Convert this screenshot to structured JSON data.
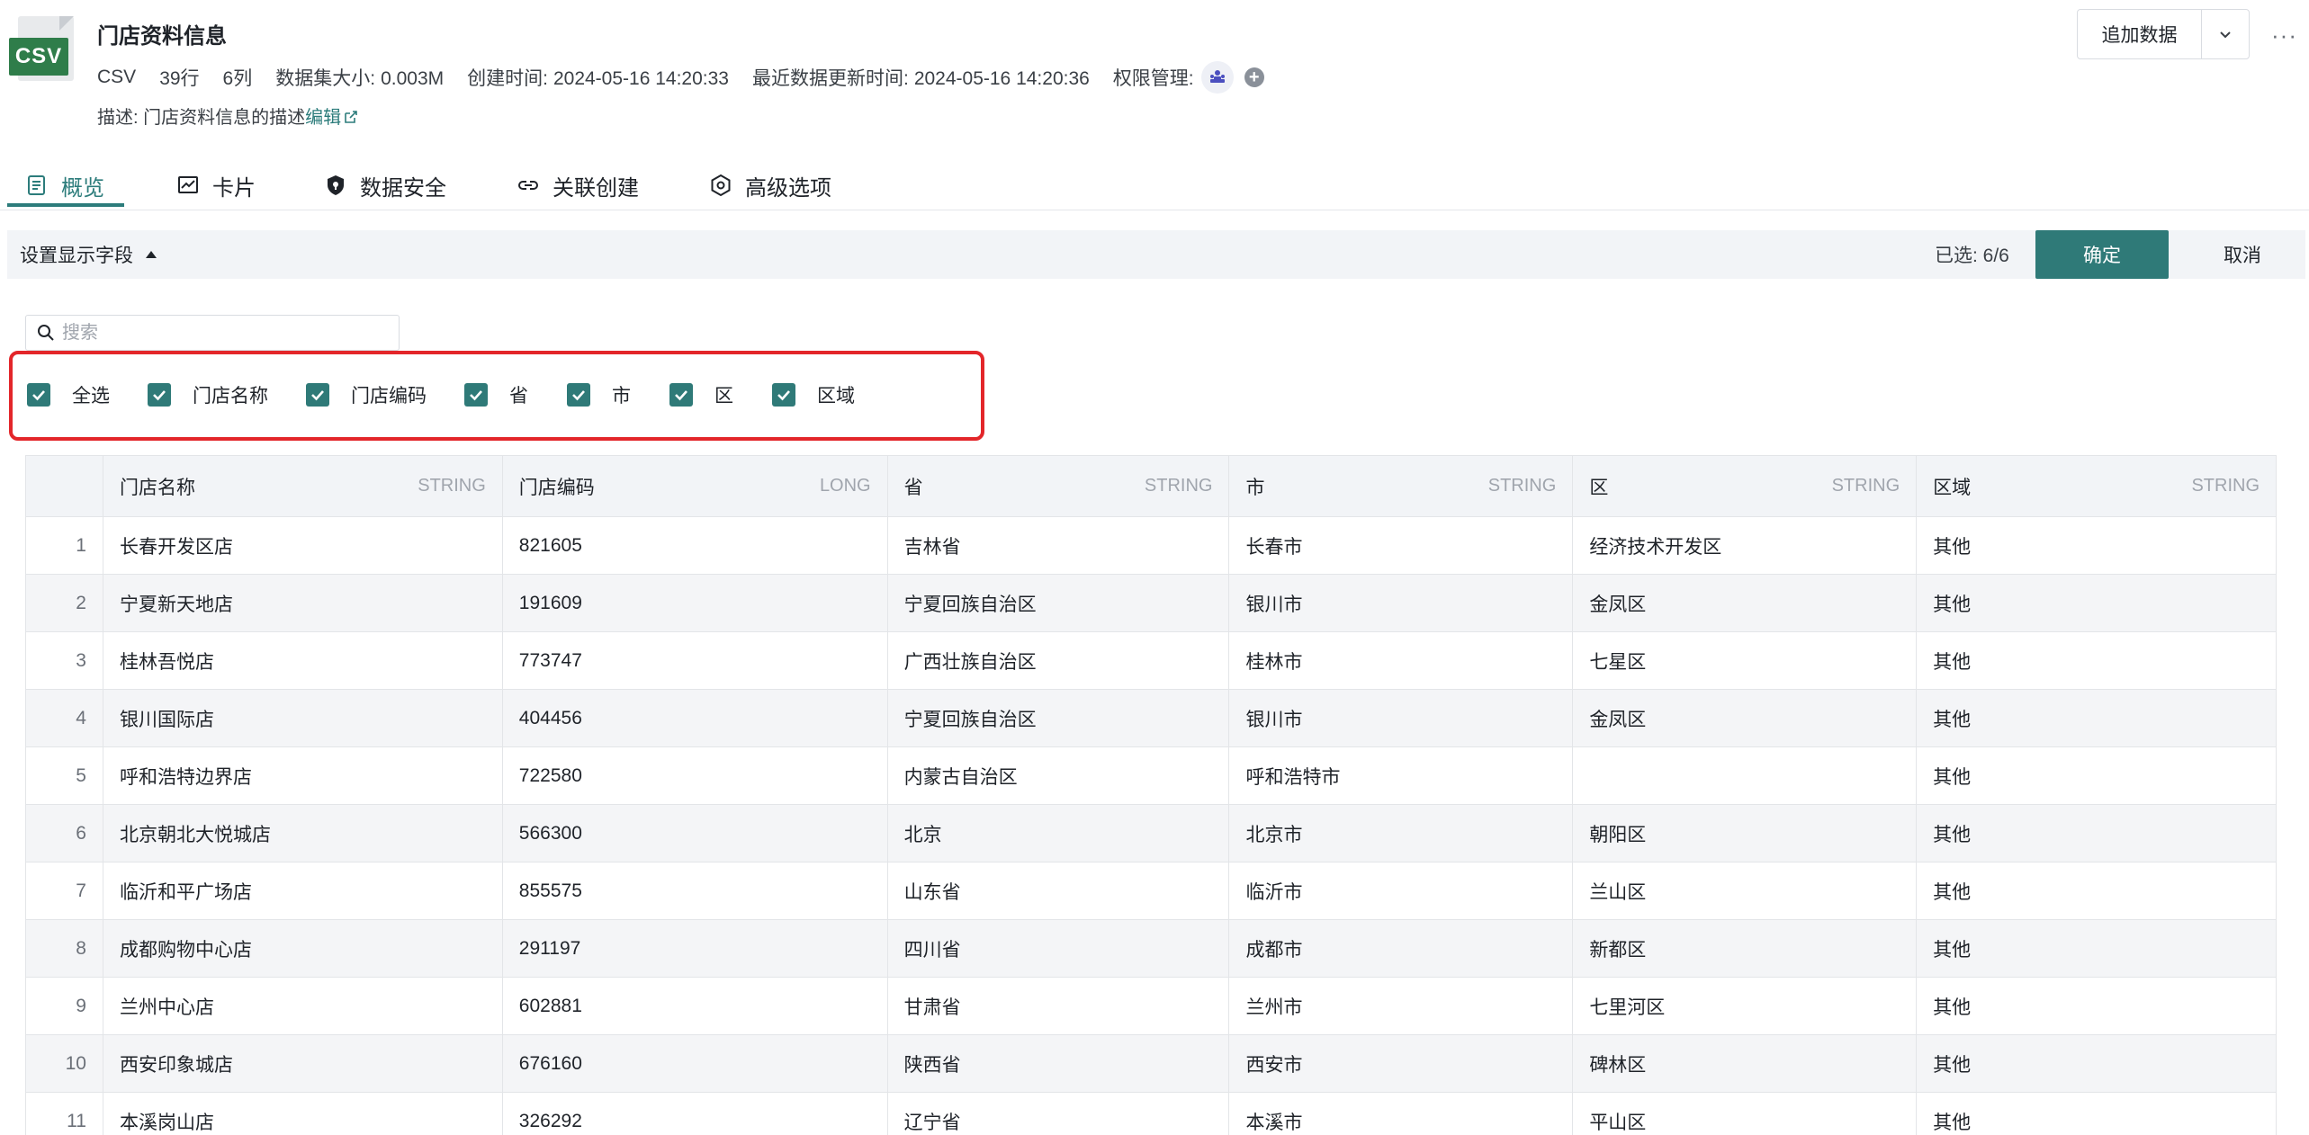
{
  "header": {
    "file_badge": "CSV",
    "title": "门店资料信息",
    "meta": {
      "format": "CSV",
      "rows": "39行",
      "cols": "6列",
      "size_label": "数据集大小:",
      "size_value": "0.003M",
      "created_label": "创建时间:",
      "created_value": "2024-05-16 14:20:33",
      "updated_label": "最近数据更新时间:",
      "updated_value": "2024-05-16 14:20:36",
      "permission_label": "权限管理:"
    },
    "desc_label": "描述:",
    "desc_text": "门店资料信息的描述",
    "desc_edit": "编辑",
    "append_button": "追加数据",
    "more": "···"
  },
  "tabs": [
    {
      "label": "概览",
      "icon": "doc-list-icon"
    },
    {
      "label": "卡片",
      "icon": "line-chart-icon"
    },
    {
      "label": "数据安全",
      "icon": "shield-icon"
    },
    {
      "label": "关联创建",
      "icon": "link-icon"
    },
    {
      "label": "高级选项",
      "icon": "gear-icon"
    }
  ],
  "field_bar": {
    "label": "设置显示字段",
    "selected": "已选: 6/6",
    "ok": "确定",
    "cancel": "取消"
  },
  "search": {
    "placeholder": "搜索"
  },
  "checkboxes": [
    "全选",
    "门店名称",
    "门店编码",
    "省",
    "市",
    "区",
    "区域"
  ],
  "table": {
    "columns": [
      {
        "name": "门店名称",
        "type": "STRING"
      },
      {
        "name": "门店编码",
        "type": "LONG"
      },
      {
        "name": "省",
        "type": "STRING"
      },
      {
        "name": "市",
        "type": "STRING"
      },
      {
        "name": "区",
        "type": "STRING"
      },
      {
        "name": "区域",
        "type": "STRING"
      }
    ],
    "rows": [
      [
        "1",
        "长春开发区店",
        "821605",
        "吉林省",
        "长春市",
        "经济技术开发区",
        "其他"
      ],
      [
        "2",
        "宁夏新天地店",
        "191609",
        "宁夏回族自治区",
        "银川市",
        "金凤区",
        "其他"
      ],
      [
        "3",
        "桂林吾悦店",
        "773747",
        "广西壮族自治区",
        "桂林市",
        "七星区",
        "其他"
      ],
      [
        "4",
        "银川国际店",
        "404456",
        "宁夏回族自治区",
        "银川市",
        "金凤区",
        "其他"
      ],
      [
        "5",
        "呼和浩特边界店",
        "722580",
        "内蒙古自治区",
        "呼和浩特市",
        "",
        "其他"
      ],
      [
        "6",
        "北京朝北大悦城店",
        "566300",
        "北京",
        "北京市",
        "朝阳区",
        "其他"
      ],
      [
        "7",
        "临沂和平广场店",
        "855575",
        "山东省",
        "临沂市",
        "兰山区",
        "其他"
      ],
      [
        "8",
        "成都购物中心店",
        "291197",
        "四川省",
        "成都市",
        "新都区",
        "其他"
      ],
      [
        "9",
        "兰州中心店",
        "602881",
        "甘肃省",
        "兰州市",
        "七里河区",
        "其他"
      ],
      [
        "10",
        "西安印象城店",
        "676160",
        "陕西省",
        "西安市",
        "碑林区",
        "其他"
      ],
      [
        "11",
        "本溪岗山店",
        "326292",
        "辽宁省",
        "本溪市",
        "平山区",
        "其他"
      ]
    ]
  },
  "colors": {
    "accent": "#2c7c7b",
    "highlight_border": "#e3262a",
    "csv_badge": "#2f7d4a"
  }
}
